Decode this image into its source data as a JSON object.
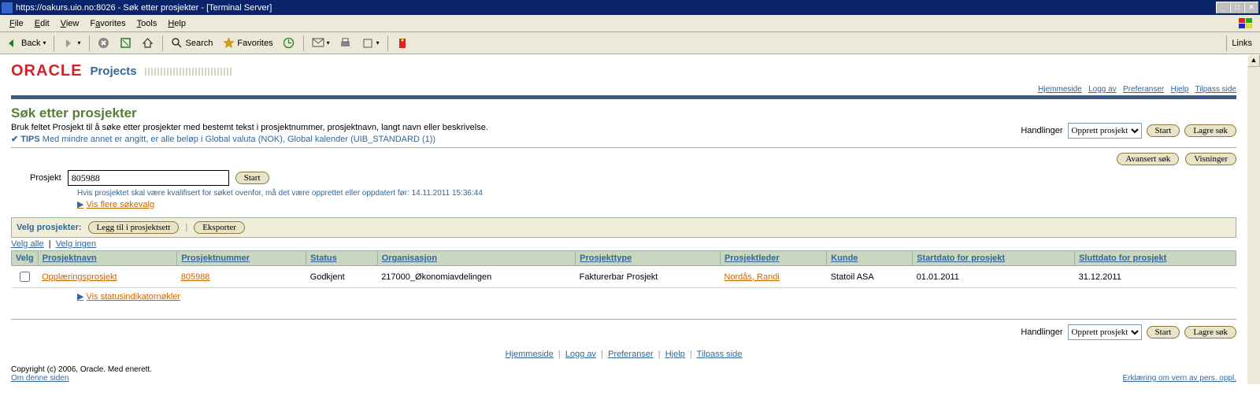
{
  "window": {
    "title": "https://oakurs.uio.no:8026 - Søk etter prosjekter - [Terminal Server]",
    "min": "_",
    "max": "□",
    "close": "×"
  },
  "menus": {
    "file": "File",
    "edit": "Edit",
    "view": "View",
    "favorites": "Favorites",
    "tools": "Tools",
    "help": "Help"
  },
  "toolbar": {
    "back": "Back",
    "search": "Search",
    "favorites": "Favorites",
    "links": "Links"
  },
  "brand": {
    "oracle": "ORACLE",
    "projects": "Projects"
  },
  "toplinks": {
    "hjemmeside": "Hjemmeside",
    "loggav": "Logg av",
    "preferanser": "Preferanser",
    "hjelp": "Hjelp",
    "tilpass": "Tilpass side"
  },
  "page": {
    "title": "Søk etter prosjekter",
    "intro": "Bruk feltet Prosjekt til å søke etter prosjekter med bestemt tekst i prosjektnummer, prosjektnavn, langt navn eller beskrivelse.",
    "tips_label": "TIPS",
    "tips_text": "Med mindre annet er angitt, er alle beløp i Global valuta (NOK), Global kalender (UIB_STANDARD (1))"
  },
  "actions": {
    "label": "Handlinger",
    "opprett": "Opprett prosjekt",
    "start": "Start",
    "lagre": "Lagre søk",
    "avansert": "Avansert søk",
    "visninger": "Visninger"
  },
  "search": {
    "label": "Prosjekt",
    "value": "805988",
    "start": "Start",
    "hint": "Hvis prosjektet skal være kvalifisert for søket ovenfor, må det være opprettet eller oppdatert før: 14.11.2011 15:36:44",
    "more": "Vis flere søkevalg"
  },
  "select_panel": {
    "label": "Velg prosjekter:",
    "leggtil": "Legg til i prosjektsett",
    "eksporter": "Eksporter",
    "velgalle": "Velg alle",
    "velgingen": "Velg ingen"
  },
  "table": {
    "headers": {
      "velg": "Velg",
      "navn": "Prosjektnavn",
      "nummer": "Prosjektnummer",
      "status": "Status",
      "org": "Organisasjon",
      "type": "Prosjekttype",
      "leder": "Prosjektleder",
      "kunde": "Kunde",
      "start": "Startdato for prosjekt",
      "slutt": "Sluttdato for prosjekt"
    },
    "rows": [
      {
        "navn": "Opplæringsprosjekt",
        "nummer": "805988",
        "status": "Godkjent",
        "org": "217000_Økonomiavdelingen",
        "type": "Fakturerbar Prosjekt",
        "leder": "Nordås, Randi",
        "kunde": "Statoil ASA",
        "start": "01.01.2011",
        "slutt": "31.12.2011"
      }
    ],
    "statusind": "Vis statusindikatornøkler"
  },
  "footer": {
    "copyright": "Copyright (c) 2006, Oracle. Med enerett.",
    "om": "Om denne siden",
    "erklering": "Erklæring om vern av pers. oppl."
  }
}
